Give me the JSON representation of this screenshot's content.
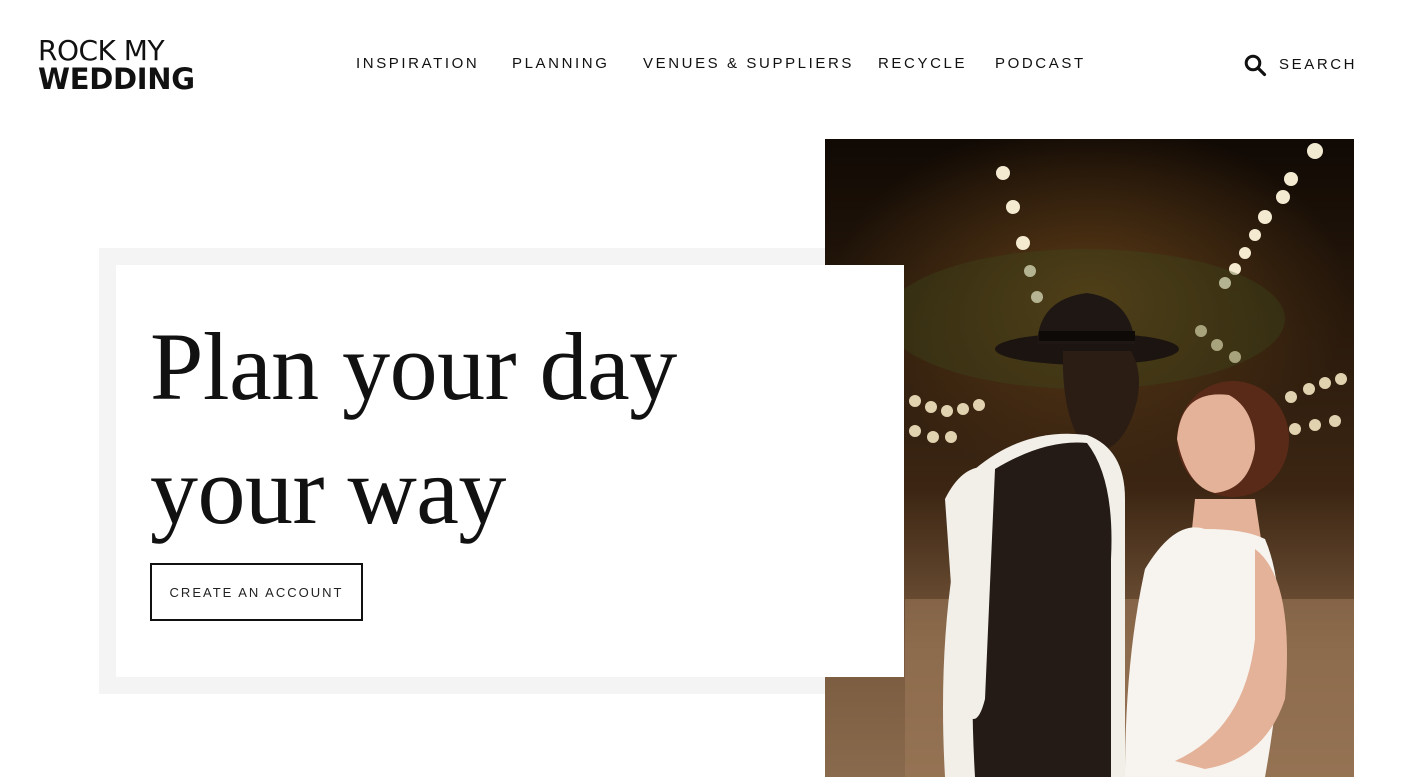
{
  "logo": {
    "line1": "ROCK MY",
    "line2": "WEDDING"
  },
  "nav": {
    "items": [
      {
        "label": "INSPIRATION"
      },
      {
        "label": "PLANNING"
      },
      {
        "label": "VENUES & SUPPLIERS"
      },
      {
        "label": "RECYCLE"
      },
      {
        "label": "PODCAST"
      }
    ]
  },
  "search": {
    "label": "SEARCH",
    "icon": "search-icon"
  },
  "hero": {
    "title_line1": "Plan your day",
    "title_line2": "your way",
    "cta_label": "CREATE AN ACCOUNT",
    "image": "photo of couple under string lights"
  },
  "colors": {
    "text": "#111111",
    "frame": "#f4f4f4",
    "background": "#ffffff"
  }
}
